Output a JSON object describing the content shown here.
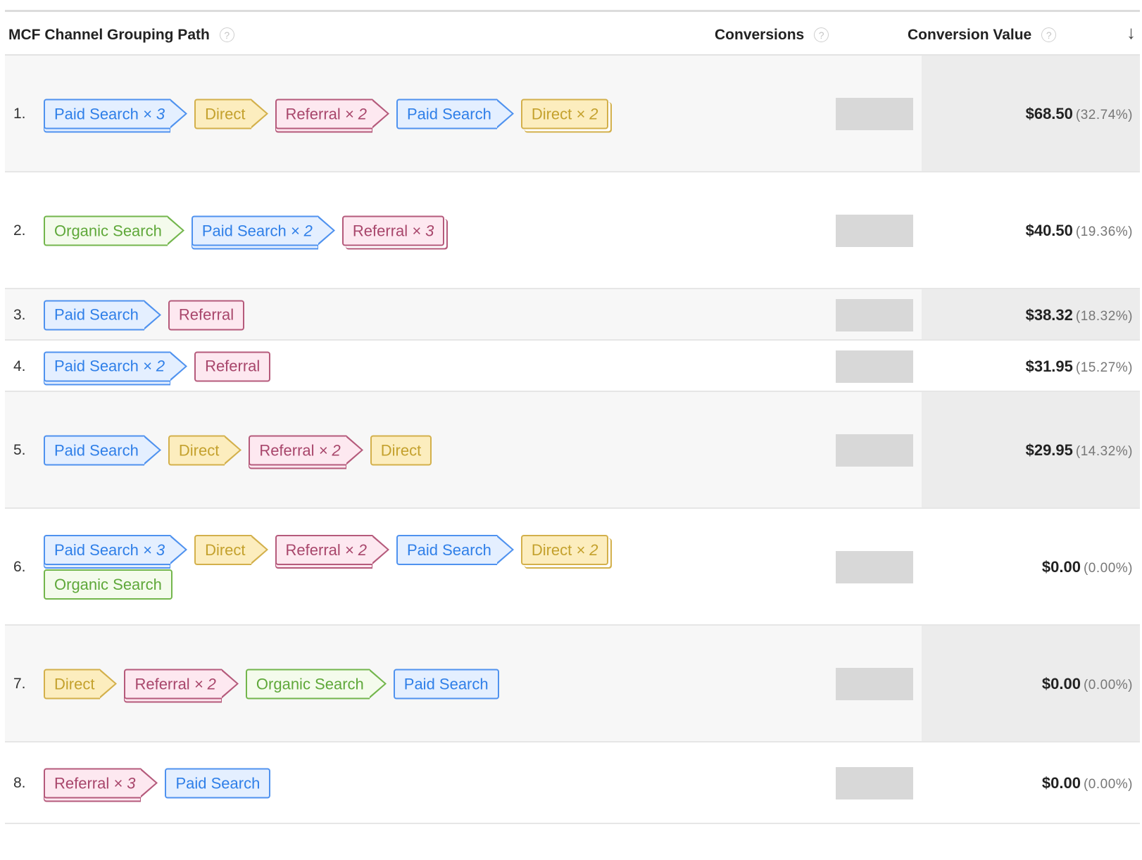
{
  "header": {
    "path_label": "MCF Channel Grouping Path",
    "conversions_label": "Conversions",
    "value_label": "Conversion Value",
    "help_glyph": "?",
    "sort_icon": "arrow-down-icon",
    "sort_glyph": "↓"
  },
  "channel_colors": {
    "Paid Search": "#4f92ef",
    "Direct": "#d3b04b",
    "Referral": "#b55a7b",
    "Organic Search": "#73b64c"
  },
  "rows": [
    {
      "index": "1.",
      "amount": "$68.50",
      "percent": "(32.74%)",
      "path": [
        {
          "label": "Paid Search",
          "mult": "× 3"
        },
        {
          "label": "Direct",
          "mult": ""
        },
        {
          "label": "Referral",
          "mult": "× 2"
        },
        {
          "label": "Paid Search",
          "mult": ""
        },
        {
          "label": "Direct",
          "mult": "× 2"
        }
      ]
    },
    {
      "index": "2.",
      "amount": "$40.50",
      "percent": "(19.36%)",
      "path": [
        {
          "label": "Organic Search",
          "mult": ""
        },
        {
          "label": "Paid Search",
          "mult": "× 2"
        },
        {
          "label": "Referral",
          "mult": "× 3"
        }
      ]
    },
    {
      "index": "3.",
      "amount": "$38.32",
      "percent": "(18.32%)",
      "path": [
        {
          "label": "Paid Search",
          "mult": ""
        },
        {
          "label": "Referral",
          "mult": ""
        }
      ]
    },
    {
      "index": "4.",
      "amount": "$31.95",
      "percent": "(15.27%)",
      "path": [
        {
          "label": "Paid Search",
          "mult": "× 2"
        },
        {
          "label": "Referral",
          "mult": ""
        }
      ]
    },
    {
      "index": "5.",
      "amount": "$29.95",
      "percent": "(14.32%)",
      "path": [
        {
          "label": "Paid Search",
          "mult": ""
        },
        {
          "label": "Direct",
          "mult": ""
        },
        {
          "label": "Referral",
          "mult": "× 2"
        },
        {
          "label": "Direct",
          "mult": ""
        }
      ]
    },
    {
      "index": "6.",
      "amount": "$0.00",
      "percent": "(0.00%)",
      "path": [
        {
          "label": "Paid Search",
          "mult": "× 3"
        },
        {
          "label": "Direct",
          "mult": ""
        },
        {
          "label": "Referral",
          "mult": "× 2"
        },
        {
          "label": "Paid Search",
          "mult": ""
        },
        {
          "label": "Direct",
          "mult": "× 2"
        },
        {
          "label": "Organic Search",
          "mult": ""
        }
      ]
    },
    {
      "index": "7.",
      "amount": "$0.00",
      "percent": "(0.00%)",
      "path": [
        {
          "label": "Direct",
          "mult": ""
        },
        {
          "label": "Referral",
          "mult": "× 2"
        },
        {
          "label": "Organic Search",
          "mult": ""
        },
        {
          "label": "Paid Search",
          "mult": ""
        }
      ]
    },
    {
      "index": "8.",
      "amount": "$0.00",
      "percent": "(0.00%)",
      "path": [
        {
          "label": "Referral",
          "mult": "× 3"
        },
        {
          "label": "Paid Search",
          "mult": ""
        }
      ]
    }
  ]
}
